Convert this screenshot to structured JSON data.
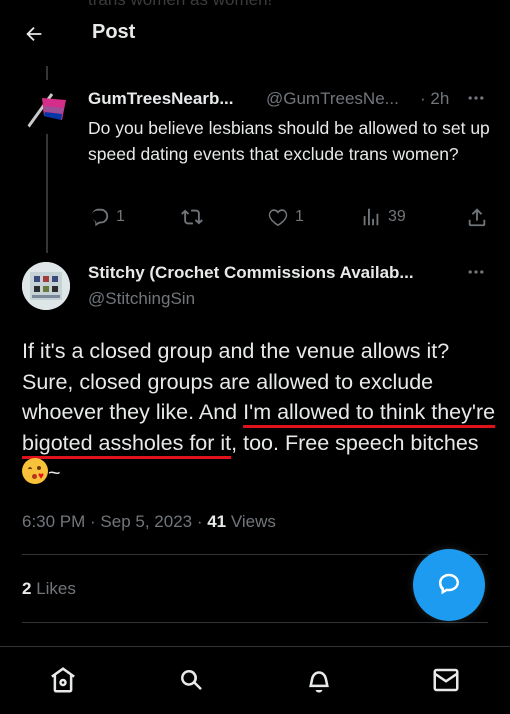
{
  "header": {
    "title": "Post",
    "faded_text": "trans women as women!"
  },
  "reply_to": {
    "display_name": "GumTreesNearb...",
    "handle": "@GumTreesNe...",
    "time": "· 2h",
    "text": "Do you believe lesbians should be allowed to set up speed dating events that exclude trans women?",
    "actions": {
      "reply_count": "1",
      "like_count": "1",
      "views_count": "39"
    }
  },
  "post": {
    "display_name": "Stitchy (Crochet Commissions Availab...",
    "handle": "@StitchingSin",
    "text_before": "If it's a closed group and the venue allows it? Sure, closed groups are allowed to exclude whoever they like. And ",
    "text_underlined": "I'm allowed to think they're bigoted assholes for it",
    "text_after": ", too. Free speech bitches ",
    "text_end": "~",
    "timestamp": "6:30 PM · Sep 5, 2023 · ",
    "views_count": "41",
    "views_label": " Views",
    "likes_count": "2",
    "likes_label": " Likes"
  },
  "icons": {
    "back": "arrow-left-icon",
    "more": "more-horizontal-icon",
    "reply": "reply-icon",
    "repost": "repost-icon",
    "like": "heart-icon",
    "views": "bar-chart-icon",
    "share": "share-icon",
    "fab": "compose-reply-icon",
    "nav": [
      "home-icon",
      "search-icon",
      "notifications-icon",
      "messages-icon"
    ]
  },
  "colors": {
    "background": "#000000",
    "text": "#e7e9ea",
    "secondary_text": "#71767b",
    "accent": "#1d9bf0",
    "annotation_red": "#e0131c"
  }
}
